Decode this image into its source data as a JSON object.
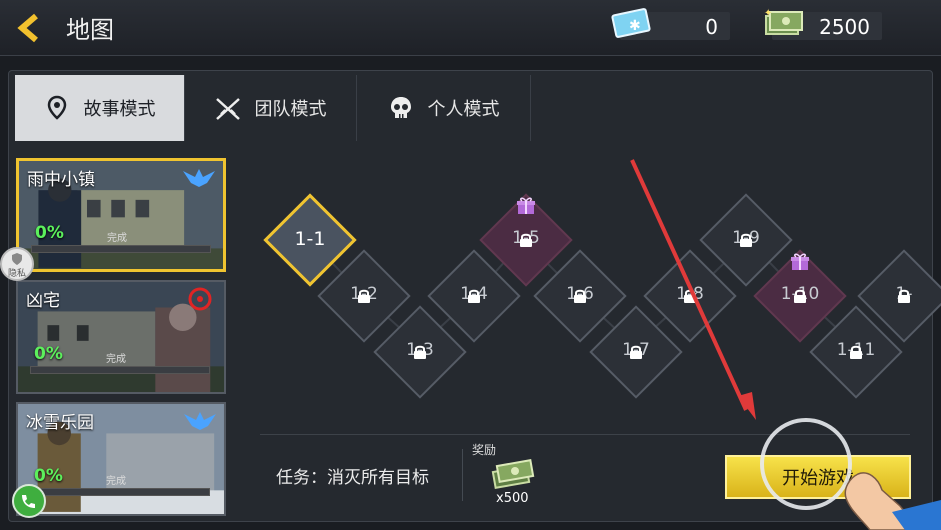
{
  "header": {
    "title": "地图",
    "diamonds": "0",
    "cash": "2500"
  },
  "tabs": [
    {
      "label": "故事模式",
      "icon": "location-pin-icon"
    },
    {
      "label": "团队模式",
      "icon": "crossed-rifles-icon"
    },
    {
      "label": "个人模式",
      "icon": "skull-icon"
    }
  ],
  "maps": [
    {
      "name": "雨中小镇",
      "progress": "0%",
      "status": "完成",
      "emblem": "eagle-icon"
    },
    {
      "name": "凶宅",
      "progress": "0%",
      "status": "完成",
      "emblem": "biohazard-icon"
    },
    {
      "name": "冰雪乐园",
      "progress": "0%",
      "status": "完成",
      "emblem": "eagle-icon"
    }
  ],
  "privacy": "隐私",
  "levels": [
    {
      "label": "1-1",
      "state": "current"
    },
    {
      "label": "1-2",
      "state": "locked"
    },
    {
      "label": "1-3",
      "state": "locked"
    },
    {
      "label": "1-4",
      "state": "locked"
    },
    {
      "label": "1-5",
      "state": "locked-gift"
    },
    {
      "label": "1-6",
      "state": "locked"
    },
    {
      "label": "1-7",
      "state": "locked"
    },
    {
      "label": "1-8",
      "state": "locked"
    },
    {
      "label": "1-9",
      "state": "locked"
    },
    {
      "label": "1-10",
      "state": "locked-gift"
    },
    {
      "label": "1-11",
      "state": "locked"
    },
    {
      "label": "1-",
      "state": "locked"
    }
  ],
  "bottom": {
    "task": "任务：消灭所有目标",
    "reward_label": "奖励",
    "reward_qty": "x500",
    "start": "开始游戏"
  },
  "colors": {
    "accent": "#f0c430",
    "progress": "#5cf05c",
    "gift": "#4b2c43",
    "arrow": "#e03a3a"
  }
}
